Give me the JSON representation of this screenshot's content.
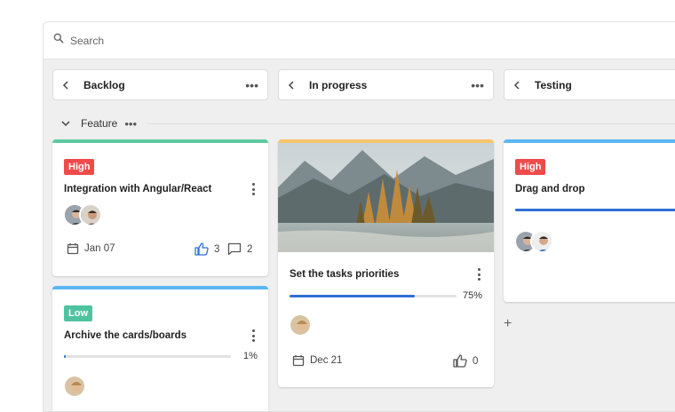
{
  "search": {
    "placeholder": "Search"
  },
  "columns": [
    {
      "title": "Backlog",
      "more": "•••"
    },
    {
      "title": "In progress",
      "more": "•••"
    },
    {
      "title": "Testing"
    }
  ],
  "group": {
    "label": "Feature",
    "more": "•••"
  },
  "cards": {
    "angular": {
      "priority": "High",
      "title": "Integration with Angular/React",
      "date": "Jan 07",
      "likes": "3",
      "comments": "2",
      "accent": "#5ccaa0"
    },
    "archive": {
      "priority": "Low",
      "title": "Archive the cards/boards",
      "progress": 0.01,
      "progress_label": "1%",
      "accent": "#5bb7f2"
    },
    "tasks": {
      "title": "Set the tasks priorities",
      "progress": 0.75,
      "progress_label": "75%",
      "date": "Dec 21",
      "likes": "0",
      "accent": "#f7c56a",
      "image": "mountain-lake-forest-photo"
    },
    "drag": {
      "priority": "High",
      "title": "Drag and drop",
      "progress": 1.0,
      "accent": "#5bb7f2"
    }
  },
  "add_label": "+",
  "colors": {
    "high": "#ef4b4b",
    "low": "#4fc3a0",
    "progress": "#2f6fd6",
    "like_active": "#2f6fd6"
  },
  "icons": [
    "search-icon",
    "chevron-left-icon",
    "chevron-down-icon",
    "more-icon",
    "kebab-icon",
    "calendar-icon",
    "thumbs-up-icon",
    "comment-icon",
    "plus-icon",
    "avatar"
  ]
}
